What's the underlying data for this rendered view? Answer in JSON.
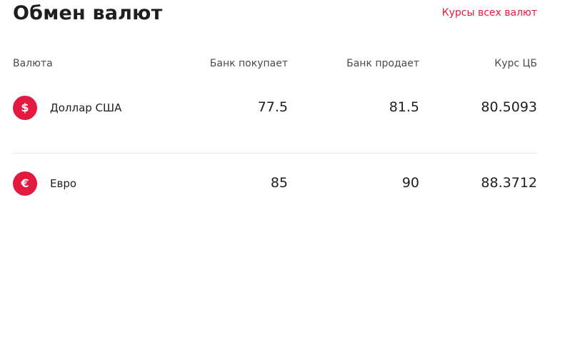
{
  "header": {
    "title": "Обмен валют",
    "all_rates_link": "Курсы всех валют"
  },
  "table": {
    "columns": {
      "currency": "Валюта",
      "bank_buys": "Банк покупает",
      "bank_sells": "Банк продает",
      "cb_rate": "Курс ЦБ"
    },
    "rows": [
      {
        "icon": "dollar-icon",
        "icon_glyph": "$",
        "name": "Доллар США",
        "buy": "77.5",
        "sell": "81.5",
        "cb": "80.5093"
      },
      {
        "icon": "euro-icon",
        "icon_glyph": "€",
        "name": "Евро",
        "buy": "85",
        "sell": "90",
        "cb": "88.3712"
      }
    ]
  },
  "colors": {
    "accent": "#e4193f",
    "text": "#1f1f1f",
    "muted": "#4a4a4a",
    "divider": "#e6e6e6"
  }
}
